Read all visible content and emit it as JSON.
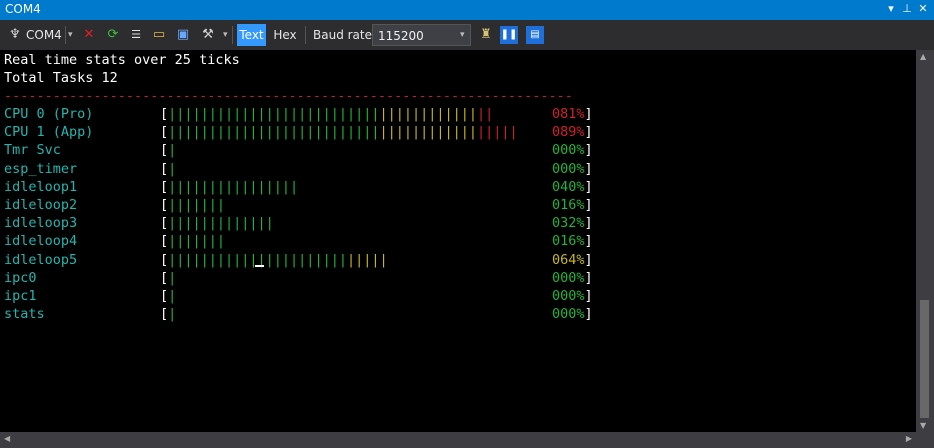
{
  "window": {
    "title": "COM4"
  },
  "toolbar": {
    "port_label": "COM4",
    "text_label": "Text",
    "hex_label": "Hex",
    "baud_label": "Baud rate:",
    "baud_value": "115200"
  },
  "terminal": {
    "header1": "Real time stats over 25 ticks",
    "header2": "Total Tasks 12",
    "divider": "----------------------------------------------------------------------",
    "rows": [
      {
        "name": "CPU 0 (Pro)",
        "open": "[",
        "bars_green": "||||||||||||||||||||||||||",
        "bars_yellow": "||||||||||||",
        "bars_red": "||",
        "percent": "081%",
        "close": "]",
        "pct_color": "red"
      },
      {
        "name": "CPU 1 (App)",
        "open": "[",
        "bars_green": "||||||||||||||||||||||||||",
        "bars_yellow": "||||||||||||",
        "bars_red": "|||||",
        "percent": "089%",
        "close": "]",
        "pct_color": "red"
      },
      {
        "name": "Tmr Svc",
        "open": "[",
        "bars_green": "|",
        "bars_yellow": "",
        "bars_red": "",
        "percent": "000%",
        "close": "]",
        "pct_color": "green"
      },
      {
        "name": "esp_timer",
        "open": "[",
        "bars_green": "|",
        "bars_yellow": "",
        "bars_red": "",
        "percent": "000%",
        "close": "]",
        "pct_color": "green"
      },
      {
        "name": "idleloop1",
        "open": "[",
        "bars_green": "||||||||||||||||",
        "bars_yellow": "",
        "bars_red": "",
        "percent": "040%",
        "close": "]",
        "pct_color": "green"
      },
      {
        "name": "idleloop2",
        "open": "[",
        "bars_green": "|||||||",
        "bars_yellow": "",
        "bars_red": "",
        "percent": "016%",
        "close": "]",
        "pct_color": "green"
      },
      {
        "name": "idleloop3",
        "open": "[",
        "bars_green": "|||||||||||||",
        "bars_yellow": "",
        "bars_red": "",
        "percent": "032%",
        "close": "]",
        "pct_color": "green"
      },
      {
        "name": "idleloop4",
        "open": "[",
        "bars_green": "|||||||",
        "bars_yellow": "",
        "bars_red": "",
        "percent": "016%",
        "close": "]",
        "pct_color": "green"
      },
      {
        "name": "idleloop5",
        "open": "[",
        "bars_green": "||||||||||||||||||||||",
        "bars_yellow": "|||||",
        "bars_red": "",
        "percent": "064%",
        "close": "]",
        "pct_color": "yellow"
      },
      {
        "name": "ipc0",
        "open": "[",
        "bars_green": "|",
        "bars_yellow": "",
        "bars_red": "",
        "percent": "000%",
        "close": "]",
        "pct_color": "green"
      },
      {
        "name": "ipc1",
        "open": "[",
        "bars_green": "|",
        "bars_yellow": "",
        "bars_red": "",
        "percent": "000%",
        "close": "]",
        "pct_color": "green"
      },
      {
        "name": "stats",
        "open": "[",
        "bars_green": "|",
        "bars_yellow": "",
        "bars_red": "",
        "percent": "000%",
        "close": "]",
        "pct_color": "green"
      }
    ]
  },
  "colors": {
    "titlebar": "#007acc",
    "toolbar": "#2d2d30",
    "task_name": "#1fb7b0",
    "bar_green": "#21b43a",
    "bar_yellow": "#c8b71a",
    "bar_red": "#d0202a",
    "divider": "#c02020"
  },
  "icons": [
    "port-icon",
    "disconnect-icon",
    "refresh-icon",
    "clear-icon",
    "open-folder-icon",
    "save-icon",
    "settings-icon",
    "pin-icon",
    "pause-icon",
    "panel-icon"
  ]
}
